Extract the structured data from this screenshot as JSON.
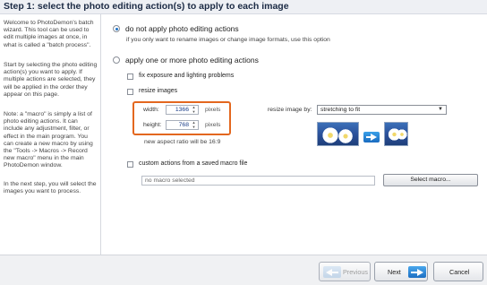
{
  "header": {
    "title": "Step 1: select the photo editing action(s) to apply to each image"
  },
  "sidebar": {
    "paragraphs": [
      "Welcome to PhotoDemon's batch wizard.  This tool can be used to edit multiple images at once, in what is called a \"batch process\".",
      "Start by selecting the photo editing action(s) you want to apply.  If multiple actions are selected, they will be applied in the order they appear on this page.",
      "Note: a \"macro\" is simply a list of photo editing actions.  It can include any adjustment, filter, or effect in the main program.  You can create a new macro by using the \"Tools -> Macros -> Record new macro\" menu in the main PhotoDemon window.",
      "In the next step, you will select the images you want to process."
    ]
  },
  "options": {
    "no_actions": {
      "label": "do not apply photo editing actions",
      "hint": "if you only want to rename images or change image formats, use this option",
      "selected": true
    },
    "apply_actions": {
      "label": "apply one or more photo editing actions",
      "selected": false
    },
    "fix_exposure": {
      "label": "fix exposure and lighting problems",
      "checked": false
    },
    "resize": {
      "label": "resize images",
      "checked": false,
      "width_label": "width:",
      "width_value": "1366",
      "height_label": "height:",
      "height_value": "768",
      "unit": "pixels",
      "aspect_text": "new aspect ratio will be 16:9",
      "mode_label": "resize image by:",
      "mode_value": "stretching to fit"
    },
    "macro": {
      "label": "custom actions from a saved macro file",
      "checked": false,
      "file_value": "no macro selected",
      "select_button": "Select macro..."
    }
  },
  "footer": {
    "previous_label": "Previous",
    "next_label": "Next",
    "cancel_label": "Cancel"
  },
  "icons": {
    "arrow": "right-arrow-icon",
    "previous": "left-arrow-icon",
    "next": "right-arrow-icon"
  },
  "colors": {
    "highlight_box": "#e3671f",
    "radio_accent": "#1e73c8",
    "arrow_blue": "#1c6fc3"
  }
}
